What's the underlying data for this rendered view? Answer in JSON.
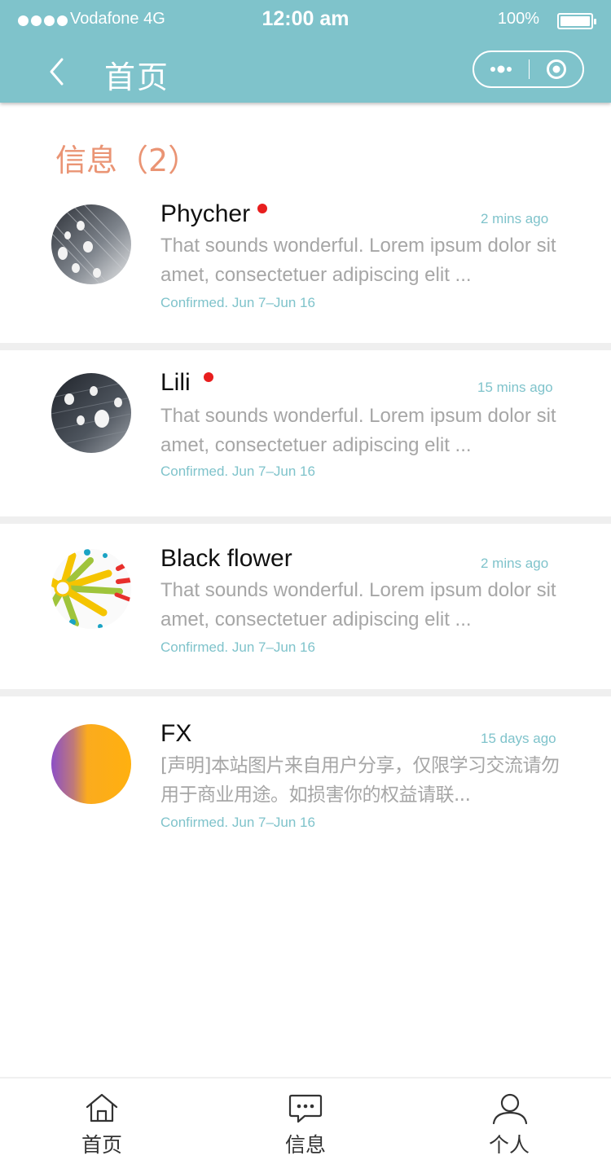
{
  "status_bar": {
    "carrier": "Vodafone 4G",
    "time": "12:00 am",
    "battery": "100%"
  },
  "nav": {
    "title": "首页",
    "back_icon": "chevron-left-icon",
    "more_icon": "more-dots-icon",
    "target_icon": "target-circle-icon"
  },
  "section": {
    "title": "信息（2）"
  },
  "messages": [
    {
      "name": "Phycher",
      "unread": true,
      "time": "2 mins ago",
      "preview": "That sounds wonderful. Lorem ipsum dolor sit amet, consectetuer adipiscing elit ...",
      "confirmed": "Confirmed. Jun 7–Jun 16"
    },
    {
      "name": "Lili",
      "unread": true,
      "time": "15 mins ago",
      "preview": "That sounds wonderful. Lorem ipsum dolor sit amet, consectetuer adipiscing elit ...",
      "confirmed": "Confirmed. Jun 7–Jun 16"
    },
    {
      "name": "Black flower",
      "unread": false,
      "time": "2 mins ago",
      "preview": "That sounds wonderful. Lorem ipsum dolor sit amet, consectetuer adipiscing elit ...",
      "confirmed": "Confirmed. Jun 7–Jun 16"
    },
    {
      "name": "FX",
      "unread": false,
      "time": "15 days ago",
      "preview": "[声明]本站图片来自用户分享，仅限学习交流请勿用于商业用途。如损害你的权益请联...",
      "confirmed": "Confirmed. Jun 7–Jun 16"
    }
  ],
  "tabbar": {
    "home": "首页",
    "messages": "信息",
    "profile": "个人"
  },
  "colors": {
    "accent": "#7fc3cb",
    "section_title": "#ea9474",
    "unread_dot": "#e81e1e"
  }
}
